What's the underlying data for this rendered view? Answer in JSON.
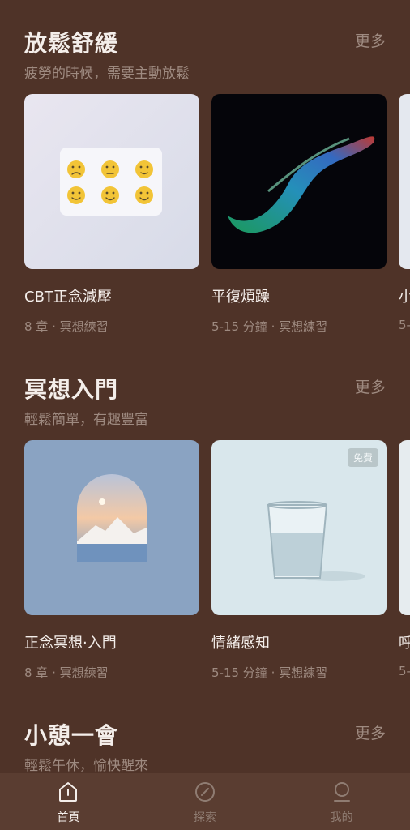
{
  "sections": [
    {
      "title": "放鬆舒緩",
      "subtitle": "疲勞的時候，需要主動放鬆",
      "more": "更多",
      "cards": [
        {
          "title": "CBT正念減壓",
          "meta": "8 章 · 冥想練習",
          "image": "smiley-faces"
        },
        {
          "title": "平復煩躁",
          "meta": "5-15 分鐘 · 冥想練習",
          "image": "colorful-smoke"
        },
        {
          "title": "小",
          "meta": "5-",
          "image": "light-panel"
        }
      ]
    },
    {
      "title": "冥想入門",
      "subtitle": "輕鬆簡單，有趣豐富",
      "more": "更多",
      "cards": [
        {
          "title": "正念冥想·入門",
          "meta": "8 章 · 冥想練習",
          "image": "arch-mountain"
        },
        {
          "title": "情緒感知",
          "meta": "5-15 分鐘 · 冥想練習",
          "image": "water-glass",
          "badge": "免費"
        },
        {
          "title": "呼",
          "meta": "5-",
          "image": "light-panel"
        }
      ]
    },
    {
      "title": "小憩一會",
      "subtitle": "輕鬆午休，愉快醒來",
      "more": "更多"
    }
  ],
  "tabs": [
    {
      "label": "首頁",
      "icon": "home-icon",
      "active": true
    },
    {
      "label": "探索",
      "icon": "compass-icon",
      "active": false
    },
    {
      "label": "我的",
      "icon": "profile-icon",
      "active": false
    }
  ],
  "colors": {
    "background": "#4f3328",
    "tabbar": "#5a3d31",
    "primary_text": "#f4eeea",
    "secondary_text": "#9e8a80"
  }
}
